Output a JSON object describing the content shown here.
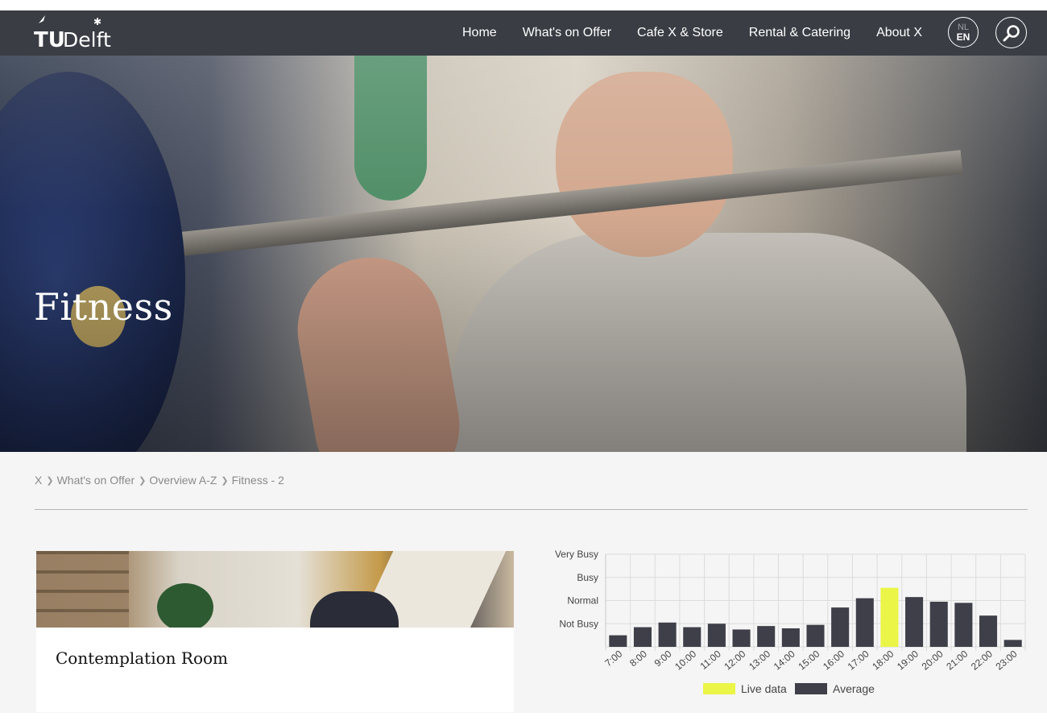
{
  "brand": {
    "logo_text": "TU Delft"
  },
  "nav": {
    "items": [
      {
        "label": "Home"
      },
      {
        "label": "What's on Offer"
      },
      {
        "label": "Cafe X & Store"
      },
      {
        "label": "Rental & Catering"
      },
      {
        "label": "About X"
      }
    ],
    "lang_alt": "NL",
    "lang_current": "EN"
  },
  "hero": {
    "title": "Fitness"
  },
  "breadcrumb": [
    {
      "label": "X"
    },
    {
      "label": "What's on Offer"
    },
    {
      "label": "Overview A-Z"
    },
    {
      "label": "Fitness - 2"
    }
  ],
  "card": {
    "title": "Contemplation Room"
  },
  "colors": {
    "navbar": "#3a3d44",
    "live": "#eaf547",
    "average": "#3f3f49",
    "background": "#f5f5f5"
  },
  "chart_data": {
    "type": "bar",
    "categories": [
      "7:00",
      "8:00",
      "9:00",
      "10:00",
      "11:00",
      "12:00",
      "13:00",
      "14:00",
      "15:00",
      "16:00",
      "17:00",
      "18:00",
      "19:00",
      "20:00",
      "21:00",
      "22:00",
      "23:00"
    ],
    "y_tick_labels": [
      "Very Busy",
      "Busy",
      "Normal",
      "Not Busy"
    ],
    "ylim": [
      0,
      4
    ],
    "series": [
      {
        "name": "Live data",
        "color": "#eaf547",
        "values": [
          null,
          null,
          null,
          null,
          null,
          null,
          null,
          null,
          null,
          null,
          null,
          2.55,
          null,
          null,
          null,
          null,
          null
        ]
      },
      {
        "name": "Average",
        "color": "#3f3f49",
        "values": [
          0.5,
          0.85,
          1.05,
          0.85,
          1.0,
          0.75,
          0.9,
          0.8,
          0.95,
          1.7,
          2.1,
          null,
          2.15,
          1.95,
          1.9,
          1.35,
          0.3
        ]
      }
    ],
    "grid": true,
    "legend": "bottom"
  }
}
